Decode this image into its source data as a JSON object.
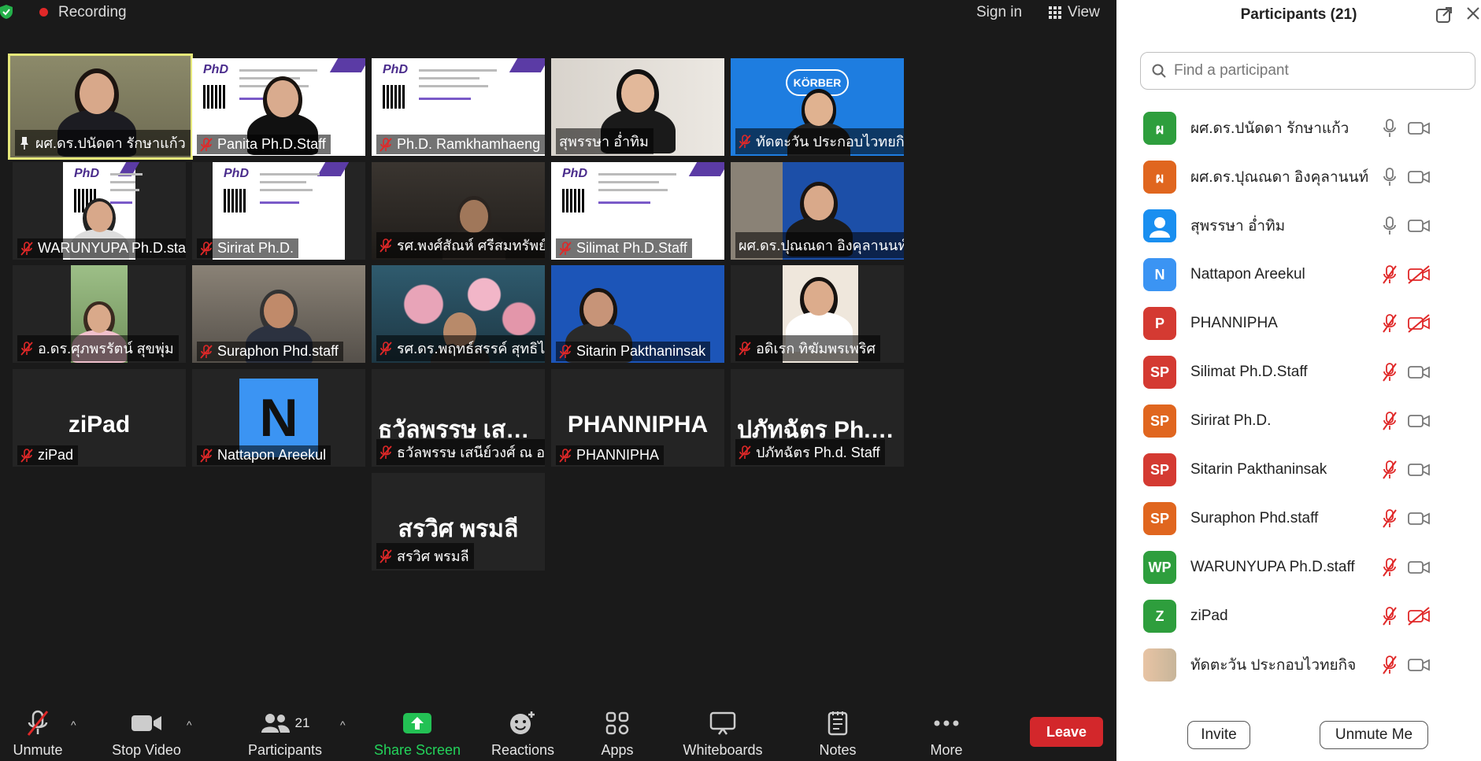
{
  "topbar": {
    "recording_label": "Recording",
    "sign_in_label": "Sign in",
    "view_label": "View"
  },
  "tiles": [
    {
      "name": "ผศ.ดร.ปนัดดา รักษาแก้ว",
      "type": "video",
      "scene": "woman",
      "pinned": true,
      "active": true
    },
    {
      "name": "Panita Ph.D.Staff",
      "type": "video",
      "scene": "poster-woman"
    },
    {
      "name": "Ph.D. Ramkhamhaeng Un...",
      "type": "video",
      "scene": "poster"
    },
    {
      "name": "สุพรรษา อ่ำทิม",
      "type": "video",
      "scene": "woman-dark",
      "unmuted": true
    },
    {
      "name": "ทัดตะวัน ประกอบไวทยกิจ",
      "type": "video",
      "scene": "korber"
    },
    {
      "name": "WARUNYUPA Ph.D.staff",
      "type": "video",
      "scene": "poster-small"
    },
    {
      "name": "Sirirat Ph.D.",
      "type": "video",
      "scene": "poster-white"
    },
    {
      "name": "รศ.พงศ์สัณห์ ศรีสมทรัพย์",
      "type": "video",
      "scene": "room"
    },
    {
      "name": "Silimat Ph.D.Staff",
      "type": "video",
      "scene": "poster"
    },
    {
      "name": "ผศ.ดร.ปุณณดา อิงคุลานนท์",
      "type": "video",
      "scene": "phd-woman",
      "unmuted": true
    },
    {
      "name": "อ.ดร.ศุภพรรัตน์ สุขพุ่ม",
      "type": "video",
      "scene": "portrait-tree"
    },
    {
      "name": "Suraphon Phd.staff",
      "type": "video",
      "scene": "man-office"
    },
    {
      "name": "รศ.ดร.พฤทธ์สรรค์ สุทธิไชยเมธี",
      "type": "video",
      "scene": "roses"
    },
    {
      "name": "Sitarin Pakthaninsak",
      "type": "video",
      "scene": "phd-blue"
    },
    {
      "name": "อดิเรก ทิฆัมพรเพริศ",
      "type": "video",
      "scene": "man-smile"
    },
    {
      "name": "ziPad",
      "type": "name",
      "big": "ziPad"
    },
    {
      "name": "Nattapon Areekul",
      "type": "initial",
      "initial": "N"
    },
    {
      "name": "ธวัลพรรษ เสนีย์วงศ์ ณ อยุธยา",
      "type": "name",
      "big": "ธวัลพรรษ เสนีย์ว..."
    },
    {
      "name": "PHANNIPHA",
      "type": "name",
      "big": "PHANNIPHA"
    },
    {
      "name": "ปภัทฉัตร Ph.d. Staff",
      "type": "name",
      "big": "ปภัทฉัตร Ph.d. S..."
    },
    {
      "name": "สรวิศ พรมลี",
      "type": "name",
      "big": "สรวิศ พรมลี"
    }
  ],
  "poster_text": "PhD",
  "korber_text": "KÖRBER",
  "toolbar": {
    "unmute": "Unmute",
    "stop_video": "Stop Video",
    "participants": "Participants",
    "participants_count": "21",
    "share_screen": "Share Screen",
    "reactions": "Reactions",
    "apps": "Apps",
    "whiteboards": "Whiteboards",
    "notes": "Notes",
    "more": "More",
    "leave": "Leave"
  },
  "panel": {
    "title": "Participants (21)",
    "search_placeholder": "Find a participant",
    "invite": "Invite",
    "unmute_me": "Unmute Me",
    "participants": [
      {
        "initial": "ผ",
        "color": "#2e9e3d",
        "name": "ผศ.ดร.ปนัดดา รักษาแก้ว",
        "mic_muted": false,
        "cam_off": false
      },
      {
        "initial": "ผ",
        "color": "#e0661f",
        "name": "ผศ.ดร.ปุณณดา อิงคุลานนท์",
        "mic_muted": false,
        "cam_off": false
      },
      {
        "initial": "",
        "color": "#1a8ff0",
        "name": "สุพรรษา อ่ำทิม",
        "mic_muted": false,
        "cam_off": false
      },
      {
        "initial": "N",
        "color": "#3b94f3",
        "name": "Nattapon Areekul",
        "mic_muted": true,
        "cam_off": true
      },
      {
        "initial": "P",
        "color": "#d43a32",
        "name": "PHANNIPHA",
        "mic_muted": true,
        "cam_off": true
      },
      {
        "initial": "SP",
        "color": "#d43a32",
        "name": "Silimat Ph.D.Staff",
        "mic_muted": true,
        "cam_off": false
      },
      {
        "initial": "SP",
        "color": "#e0661f",
        "name": "Sirirat Ph.D.",
        "mic_muted": true,
        "cam_off": false
      },
      {
        "initial": "SP",
        "color": "#d43a32",
        "name": "Sitarin Pakthaninsak",
        "mic_muted": true,
        "cam_off": false
      },
      {
        "initial": "SP",
        "color": "#e0661f",
        "name": "Suraphon Phd.staff",
        "mic_muted": true,
        "cam_off": false
      },
      {
        "initial": "WP",
        "color": "#2e9e3d",
        "name": "WARUNYUPA Ph.D.staff",
        "mic_muted": true,
        "cam_off": false
      },
      {
        "initial": "Z",
        "color": "#2e9e3d",
        "name": "ziPad",
        "mic_muted": true,
        "cam_off": true
      },
      {
        "initial": "",
        "color": "#c7b59a",
        "name": "ทัดตะวัน ประกอบไวทยกิจ",
        "mic_muted": true,
        "cam_off": false,
        "photo": true
      }
    ]
  }
}
